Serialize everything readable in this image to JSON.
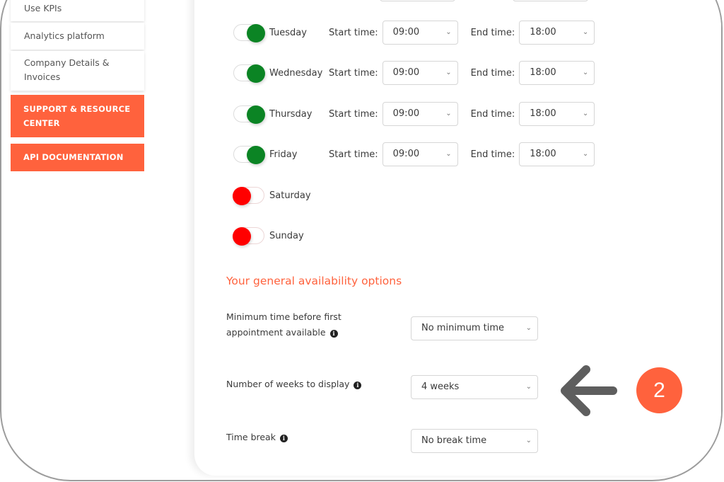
{
  "sidebar": {
    "items": [
      {
        "label": "Use KPIs"
      },
      {
        "label": "Analytics platform"
      },
      {
        "label": "Company Details & Invoices"
      }
    ],
    "buttons": [
      {
        "label": "SUPPORT & RESOURCE CENTER"
      },
      {
        "label": "API DOCUMENTATION"
      }
    ]
  },
  "schedule": {
    "start_label": "Start time:",
    "end_label": "End time:",
    "days": [
      {
        "day": "Tuesday",
        "enabled": true,
        "start": "09:00",
        "end": "18:00"
      },
      {
        "day": "Wednesday",
        "enabled": true,
        "start": "09:00",
        "end": "18:00"
      },
      {
        "day": "Thursday",
        "enabled": true,
        "start": "09:00",
        "end": "18:00"
      },
      {
        "day": "Friday",
        "enabled": true,
        "start": "09:00",
        "end": "18:00"
      },
      {
        "day": "Saturday",
        "enabled": false
      },
      {
        "day": "Sunday",
        "enabled": false
      }
    ]
  },
  "options": {
    "title": "Your general availability options",
    "min_time": {
      "label_line1": "Minimum time before first",
      "label_line2": "appointment available",
      "value": "No minimum time"
    },
    "weeks": {
      "label": "Number of weeks to display",
      "value": "4 weeks"
    },
    "time_break": {
      "label": "Time break",
      "value": "No break time"
    }
  },
  "annotation": {
    "step": "2",
    "icon": "arrow-left-icon"
  },
  "colors": {
    "accent": "#ff623d",
    "toggle_on": "#0b8424",
    "toggle_off": "#ff0000"
  },
  "icons": {
    "chevron": "⌄",
    "info": "i"
  }
}
